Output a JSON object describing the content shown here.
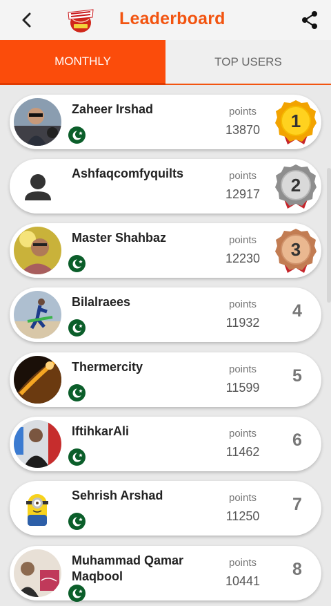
{
  "header": {
    "title": "Leaderboard",
    "logo_text": "CRICKET FANTASY LEAGUE"
  },
  "tabs": [
    {
      "label": "MONTHLY",
      "active": true
    },
    {
      "label": "TOP USERS",
      "active": false
    }
  ],
  "points_label": "points",
  "colors": {
    "brand": "#f25410",
    "gold": "#f4b000",
    "silver": "#9a9a9a",
    "bronze": "#c9855a"
  },
  "entries": [
    {
      "rank": "1",
      "name": "Zaheer Irshad",
      "points": "13870",
      "medal": "gold",
      "flag": true
    },
    {
      "rank": "2",
      "name": "Ashfaqcomfyquilts",
      "points": "12917",
      "medal": "silver",
      "flag": false
    },
    {
      "rank": "3",
      "name": "Master Shahbaz",
      "points": "12230",
      "medal": "bronze",
      "flag": true
    },
    {
      "rank": "4",
      "name": "Bilalraees",
      "points": "11932",
      "flag": true
    },
    {
      "rank": "5",
      "name": "Thermercity",
      "points": "11599",
      "flag": true
    },
    {
      "rank": "6",
      "name": "IftihkarAli",
      "points": "11462",
      "flag": true
    },
    {
      "rank": "7",
      "name": "Sehrish Arshad",
      "points": "11250",
      "flag": true
    },
    {
      "rank": "8",
      "name": "Muhammad Qamar Maqbool",
      "points": "10441",
      "flag": true
    }
  ]
}
